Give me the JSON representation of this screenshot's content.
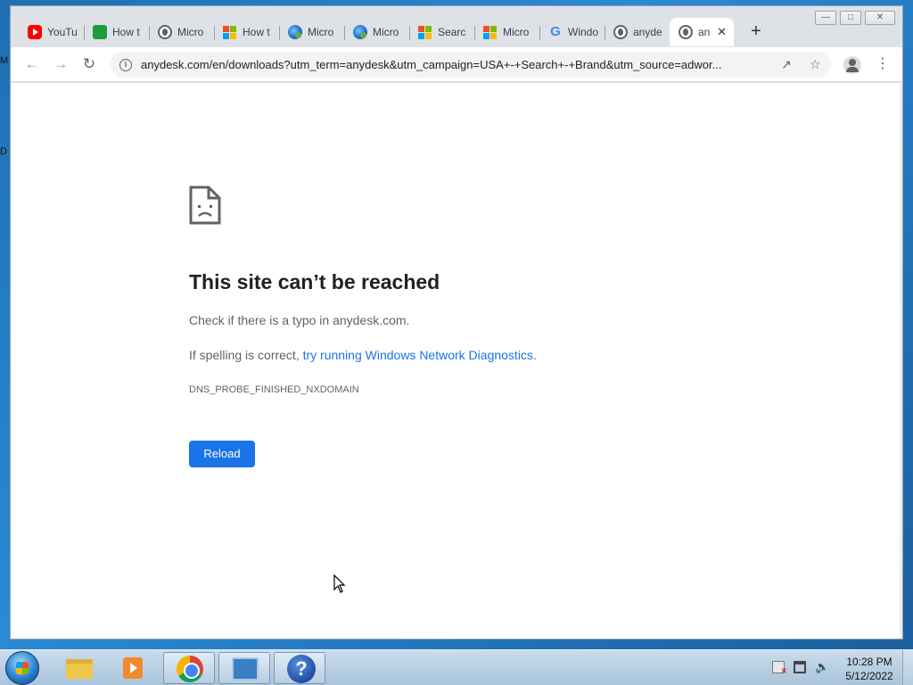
{
  "desktop": {
    "label_top": "M",
    "label_mid": "D"
  },
  "browser": {
    "window_controls": {
      "minimize": "—",
      "maximize": "□",
      "close": "✕"
    },
    "tabs": [
      {
        "title": "YouTu",
        "icon": "youtube-icon"
      },
      {
        "title": "How t",
        "icon": "howto-icon"
      },
      {
        "title": "Micro",
        "icon": "globe-icon"
      },
      {
        "title": "How t",
        "icon": "microsoft-icon"
      },
      {
        "title": "Micro",
        "icon": "edge-icon"
      },
      {
        "title": "Micro",
        "icon": "edge-icon"
      },
      {
        "title": "Searc",
        "icon": "microsoft-icon"
      },
      {
        "title": "Micro",
        "icon": "microsoft-icon"
      },
      {
        "title": "Windo",
        "icon": "google-icon"
      },
      {
        "title": "anyde",
        "icon": "globe-icon"
      },
      {
        "title": "an",
        "icon": "globe-icon",
        "active": true
      }
    ],
    "new_tab_label": "+",
    "close_tab_glyph": "✕",
    "back_glyph": "←",
    "forward_glyph": "→",
    "reload_glyph": "↻",
    "address": "anydesk.com/en/downloads?utm_term=anydesk&utm_campaign=USA+-+Search+-+Brand&utm_source=adwor...",
    "share_glyph": "↗",
    "bookmark_glyph": "☆",
    "menu_glyph": "⋮"
  },
  "error_page": {
    "title": "This site can’t be reached",
    "line1": "Check if there is a typo in anydesk.com.",
    "line2_prefix": "If spelling is correct, ",
    "line2_link": "try running Windows Network Diagnostics",
    "line2_suffix": ".",
    "error_code": "DNS_PROBE_FINISHED_NXDOMAIN",
    "reload_button": "Reload"
  },
  "taskbar": {
    "help_glyph": "?",
    "volume_glyph": "🔈",
    "clock_time": "10:28 PM",
    "clock_date": "5/12/2022"
  },
  "colors": {
    "accent": "#1a73e8",
    "title_text": "#202124",
    "body_text": "#5f6368"
  }
}
